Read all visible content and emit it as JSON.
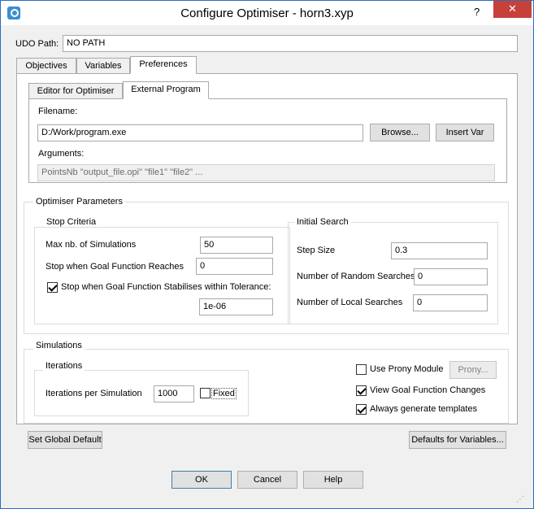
{
  "window": {
    "title": "Configure Optimiser - horn3.xyp",
    "help_glyph": "?",
    "close_glyph": "✕"
  },
  "udo": {
    "label": "UDO Path:",
    "value": "NO PATH"
  },
  "tabs": [
    {
      "label": "Objectives"
    },
    {
      "label": "Variables"
    },
    {
      "label": "Preferences"
    }
  ],
  "subtabs": [
    {
      "label": "Editor for Optimiser"
    },
    {
      "label": "External Program"
    }
  ],
  "external": {
    "filename_label": "Filename:",
    "filename_value": "D:/Work/program.exe",
    "browse_label": "Browse...",
    "insert_var_label": "Insert Var",
    "arguments_label": "Arguments:",
    "arguments_value": "PointsNb \"output_file.opi\" \"file1\" \"file2\" ..."
  },
  "optimiser": {
    "title": "Optimiser Parameters",
    "stop": {
      "title": "Stop Criteria",
      "max_sim_label": "Max nb. of Simulations",
      "max_sim_value": "50",
      "goal_reach_label": "Stop when Goal Function Reaches",
      "goal_reach_value": "0",
      "stabilise_label": "Stop when Goal Function Stabilises within Tolerance:",
      "stabilise_checked": true,
      "tolerance_value": "1e-06"
    },
    "initial": {
      "title": "Initial Search",
      "step_label": "Step Size",
      "step_value": "0.3",
      "random_label": "Number of Random Searches",
      "random_value": "0",
      "local_label": "Number of Local Searches",
      "local_value": "0"
    }
  },
  "simulations": {
    "title": "Simulations",
    "iterations": {
      "title": "Iterations",
      "per_sim_label": "Iterations per Simulation",
      "per_sim_value": "1000",
      "fixed_label": "Fixed",
      "fixed_checked": false
    },
    "prony_label": "Use Prony Module",
    "prony_checked": false,
    "prony_button": "Prony...",
    "view_goal_label": "View Goal Function Changes",
    "view_goal_checked": true,
    "templates_label": "Always generate templates",
    "templates_checked": true
  },
  "buttons": {
    "global_default": "Set Global Default",
    "defaults_vars": "Defaults for Variables...",
    "ok": "OK",
    "cancel": "Cancel",
    "help": "Help"
  }
}
